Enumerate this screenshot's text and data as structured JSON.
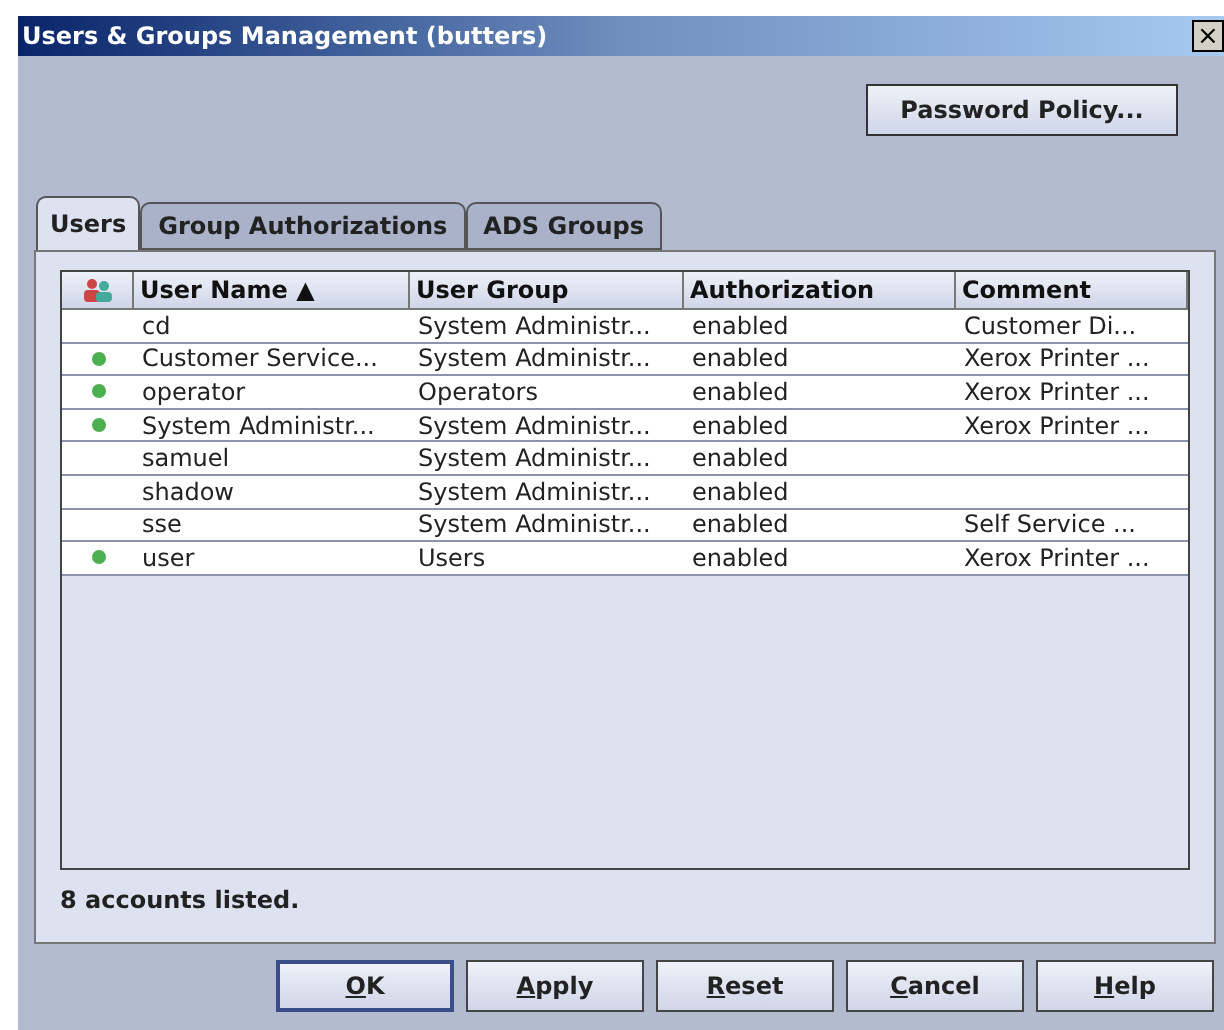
{
  "window": {
    "title": "Users & Groups Management (butters)",
    "close": "×"
  },
  "password_policy_button": "Password Policy...",
  "tabs": [
    {
      "label": "Users",
      "selected": true
    },
    {
      "label": "Group Authorizations",
      "selected": false
    },
    {
      "label": "ADS Groups",
      "selected": false
    }
  ],
  "table": {
    "columns": [
      "User Name ▲",
      "User Group",
      "Authorization",
      "Comment"
    ],
    "rows": [
      {
        "active": false,
        "cells": [
          "cd",
          "System Administr...",
          "enabled",
          "Customer Di..."
        ]
      },
      {
        "active": true,
        "cells": [
          "Customer Service...",
          "System Administr...",
          "enabled",
          "Xerox Printer ..."
        ]
      },
      {
        "active": true,
        "cells": [
          "operator",
          "Operators",
          "enabled",
          "Xerox Printer ..."
        ]
      },
      {
        "active": true,
        "cells": [
          "System Administr...",
          "System Administr...",
          "enabled",
          "Xerox Printer ..."
        ]
      },
      {
        "active": false,
        "cells": [
          "samuel",
          "System Administr...",
          "enabled",
          ""
        ]
      },
      {
        "active": false,
        "cells": [
          "shadow",
          "System Administr...",
          "enabled",
          ""
        ]
      },
      {
        "active": false,
        "cells": [
          "sse",
          "System Administr...",
          "enabled",
          "Self Service ..."
        ]
      },
      {
        "active": true,
        "cells": [
          "user",
          "Users",
          "enabled",
          "Xerox Printer ..."
        ]
      }
    ]
  },
  "status": "8 accounts listed.",
  "buttons": [
    {
      "mnemonic": "O",
      "rest": "K",
      "default": true
    },
    {
      "mnemonic": "A",
      "rest": "pply",
      "default": false
    },
    {
      "mnemonic": "R",
      "rest": "eset",
      "default": false
    },
    {
      "mnemonic": "C",
      "rest": "ancel",
      "default": false
    },
    {
      "mnemonic": "H",
      "rest": "elp",
      "default": false
    }
  ]
}
